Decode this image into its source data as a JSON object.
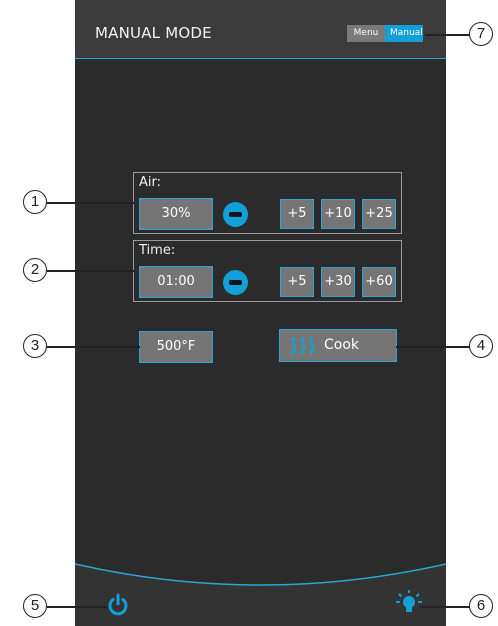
{
  "header": {
    "title": "MANUAL MODE",
    "mode_toggle": {
      "menu_label": "Menu",
      "manual_label": "Manual",
      "selected": "Manual"
    }
  },
  "air": {
    "label": "Air:",
    "value": "30%",
    "increments": [
      "+5",
      "+10",
      "+25"
    ]
  },
  "time": {
    "label": "Time:",
    "value": "01:00",
    "increments": [
      "+5",
      "+30",
      "+60"
    ]
  },
  "temperature": {
    "value": "500°F"
  },
  "cook": {
    "label": "Cook",
    "icon": "heat-waves-icon"
  },
  "footer": {
    "power_icon": "power-icon",
    "light_icon": "light-bulb-icon"
  },
  "callouts": [
    "1",
    "2",
    "3",
    "4",
    "5",
    "6",
    "7"
  ],
  "colors": {
    "accent": "#13a0d8",
    "background": "#2b2b2b",
    "header": "#3b3b3b",
    "button": "#757575"
  }
}
